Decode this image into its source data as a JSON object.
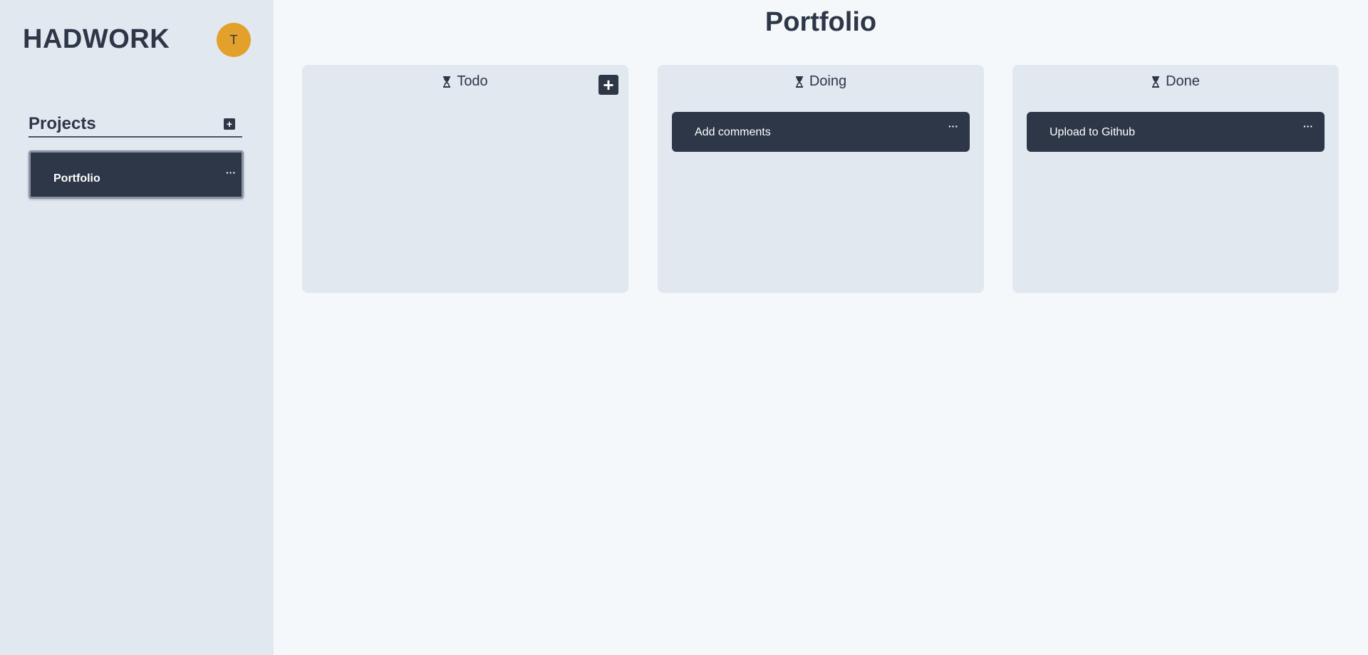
{
  "sidebar": {
    "brand": "HADWORK",
    "avatar_initial": "T",
    "projects_title": "Projects",
    "add_project_icon": "+",
    "projects": [
      {
        "label": "Portfolio",
        "menu": "···"
      }
    ]
  },
  "main": {
    "page_title": "Portfolio",
    "add_task_icon": "+",
    "columns": [
      {
        "title": "Todo",
        "icon": "hourglass-icon",
        "cards": []
      },
      {
        "title": "Doing",
        "icon": "hourglass-icon",
        "cards": [
          {
            "label": "Add comments",
            "menu": "···"
          }
        ]
      },
      {
        "title": "Done",
        "icon": "hourglass-icon",
        "cards": [
          {
            "label": "Upload to Github",
            "menu": "···"
          }
        ]
      }
    ]
  },
  "colors": {
    "sidebar_bg": "#e2e8f0",
    "main_bg": "#f5f8fb",
    "dark": "#2d3748",
    "avatar": "#e3a02a",
    "column_bg": "#e2e8f0"
  }
}
